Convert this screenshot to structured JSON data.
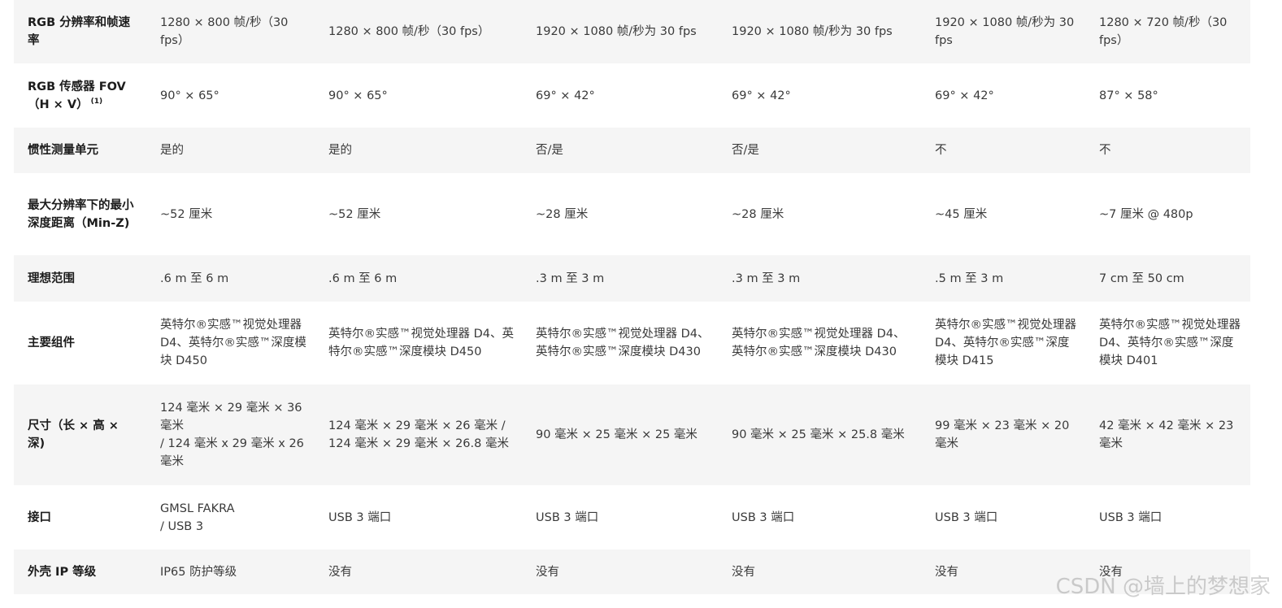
{
  "table": {
    "rows": [
      {
        "label": "RGB 分辨率和帧速率",
        "cells": [
          "1280 × 800 帧/秒（30 fps）",
          "1280 × 800 帧/秒（30 fps）",
          "1920 × 1080 帧/秒为 30 fps",
          "1920 × 1080 帧/秒为 30 fps",
          "1920 × 1080 帧/秒为 30 fps",
          "1280 × 720 帧/秒（30 fps）"
        ]
      },
      {
        "label": "RGB 传感器 FOV（H × V）",
        "footnote": "(1)",
        "cells": [
          "90° × 65°",
          "90° × 65°",
          "69° × 42°",
          "69° × 42°",
          "69° × 42°",
          "87° × 58°"
        ]
      },
      {
        "label": "惯性测量单元",
        "cells": [
          "是的",
          "是的",
          "否/是",
          "否/是",
          "不",
          "不"
        ]
      },
      {
        "label": "最大分辨率下的最小深度距离（Min-Z)",
        "cells": [
          "~52 厘米",
          "~52 厘米",
          "~28 厘米",
          "~28 厘米",
          "~45 厘米",
          "~7 厘米 @ 480p"
        ]
      },
      {
        "label": "理想范围",
        "cells": [
          ".6 m 至 6 m",
          ".6 m 至 6 m",
          ".3 m 至 3 m",
          ".3 m 至 3 m",
          ".5 m 至 3 m",
          "7 cm 至 50 cm"
        ]
      },
      {
        "label": "主要组件",
        "cells": [
          "英特尔®实感™视觉处理器 D4、英特尔®实感™深度模块 D450",
          "英特尔®实感™视觉处理器 D4、英特尔®实感™深度模块 D450",
          "英特尔®实感™视觉处理器 D4、英特尔®实感™深度模块 D430",
          "英特尔®实感™视觉处理器 D4、英特尔®实感™深度模块 D430",
          "英特尔®实感™视觉处理器 D4、英特尔®实感™深度模块 D415",
          "英特尔®实感™视觉处理器 D4、英特尔®实感™深度模块 D401"
        ]
      },
      {
        "label": "尺寸（长 × 高 × 深)",
        "cells": [
          "124 毫米 × 29 毫米 × 36 毫米\n/ 124 毫米 x 29 毫米 x 26 毫米",
          "124 毫米 × 29 毫米 × 26 毫米 / 124 毫米 × 29 毫米 × 26.8 毫米",
          "90 毫米 × 25 毫米 × 25 毫米",
          "90 毫米 × 25 毫米 × 25.8 毫米",
          "99 毫米 × 23 毫米 × 20 毫米",
          "42 毫米 × 42 毫米 × 23 毫米"
        ]
      },
      {
        "label": "接口",
        "cells": [
          "GMSL FAKRA\n/ USB 3",
          "USB 3 端口",
          "USB 3 端口",
          "USB 3 端口",
          "USB 3 端口",
          "USB 3 端口"
        ]
      },
      {
        "label": "外壳 IP 等级",
        "cells": [
          "IP65 防护等级",
          "没有",
          "没有",
          "没有",
          "没有",
          "没有"
        ]
      }
    ]
  },
  "watermark": "CSDN @墙上的梦想家"
}
